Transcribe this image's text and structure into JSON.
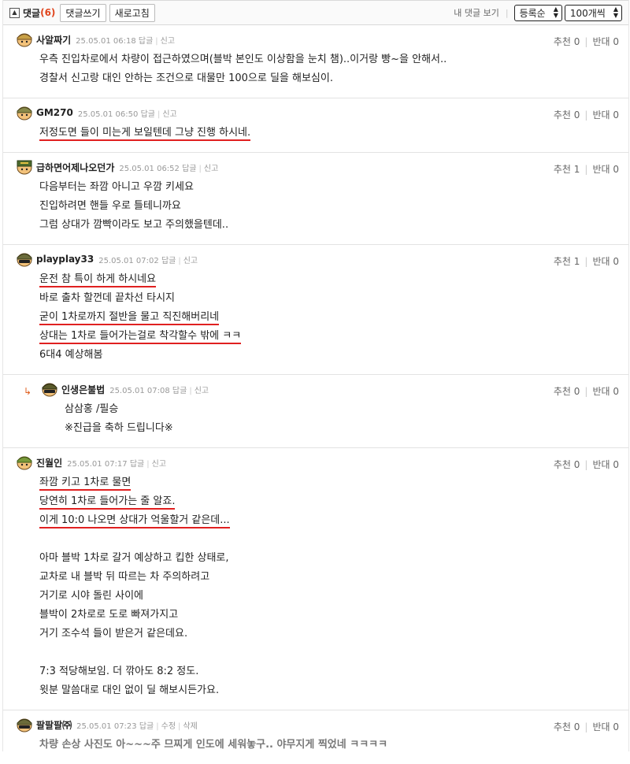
{
  "header": {
    "title": "댓글",
    "count": "(6)",
    "write_label": "댓글쓰기",
    "refresh_label": "새로고침",
    "my_comments_label": "내 댓글 보기",
    "sort_value": "등록순",
    "per_page_value": "100개씩"
  },
  "comments": [
    {
      "nick": "사알짜기",
      "time": "25.05.01 06:18",
      "reply_label": "답글",
      "report_label": "신고",
      "up": "추천 0",
      "down": "반대 0",
      "lines": [
        "우측 진입차로에서 차량이 접근하였으며(블박 본인도 이상함을 눈치 챔)..이거랑 빵~을 안해서..",
        "경찰서 신고랑 대인 안하는 조건으로 대물만 100으로 딜을 해보심이."
      ]
    },
    {
      "nick": "GM270",
      "time": "25.05.01 06:50",
      "reply_label": "답글",
      "report_label": "신고",
      "up": "추천 0",
      "down": "반대 0",
      "lines": [
        "저정도면 들이 미는게 보일텐데 그냥 진행 하시네."
      ]
    },
    {
      "nick": "급하면어제나오던가",
      "time": "25.05.01 06:52",
      "reply_label": "답글",
      "report_label": "신고",
      "up": "추천 1",
      "down": "반대 0",
      "lines": [
        "다음부터는 좌깜 아니고 우깜 키세요",
        "진입하려면 핸들 우로 틀테니까요",
        "그럼 상대가 깜빡이라도 보고 주의했을텐데.."
      ]
    },
    {
      "nick": "playplay33",
      "time": "25.05.01 07:02",
      "reply_label": "답글",
      "report_label": "신고",
      "up": "추천 1",
      "down": "반대 0",
      "lines": [
        "운전 참 특이 하게 하시네요",
        "바로 출차 할껀데 끝차선 타시지",
        "굳이 1차로까지 절반을 물고 직진해버리네",
        "상대는 1차로 들어가는걸로 착각할수 밖에 ㅋㅋ",
        "6대4 예상해봄"
      ]
    },
    {
      "nick": "인생은불법",
      "time": "25.05.01 07:08",
      "reply_label": "답글",
      "report_label": "신고",
      "up": "추천 0",
      "down": "반대 0",
      "lines": [
        "삼삼홍 /필승",
        "※진급을 축하 드립니다※"
      ]
    },
    {
      "nick": "진월인",
      "time": "25.05.01 07:17",
      "reply_label": "답글",
      "report_label": "신고",
      "up": "추천 0",
      "down": "반대 0",
      "lines": [
        "좌깜 키고 1차로 물면",
        "당연히 1차로 들어가는 줄 알죠.",
        "이게 10:0 나오면 상대가 억울할거 같은데...",
        "",
        "아마 블박 1차로 갈거 예상하고 킵한 상태로,",
        "교차로 내 블박 뒤 따르는 차 주의하려고",
        "거기로 시야 돌린 사이에",
        "블박이 2차로로 도로 빠져가지고",
        "거기 조수석 들이 받은거 같은데요.",
        "",
        "7:3 적당해보임. 더 깎아도 8:2 정도.",
        "윗분 말씀대로 대인 없이 딜 해보시든가요."
      ]
    },
    {
      "nick": "팔팔팔㈜",
      "time": "25.05.01 07:23",
      "reply_label": "답글",
      "edit_label": "수정",
      "delete_label": "삭제",
      "up": "추천 0",
      "down": "반대 0",
      "lines": [
        "차량 손상 사진도 아~~~주 므찌게 인도에 세워놓구.. 야무지게 찍었네 ㅋㅋㅋㅋ"
      ]
    }
  ],
  "colors": {
    "underline": "#e02020",
    "count": "#e0461f",
    "reply_arrow": "#e06020"
  }
}
